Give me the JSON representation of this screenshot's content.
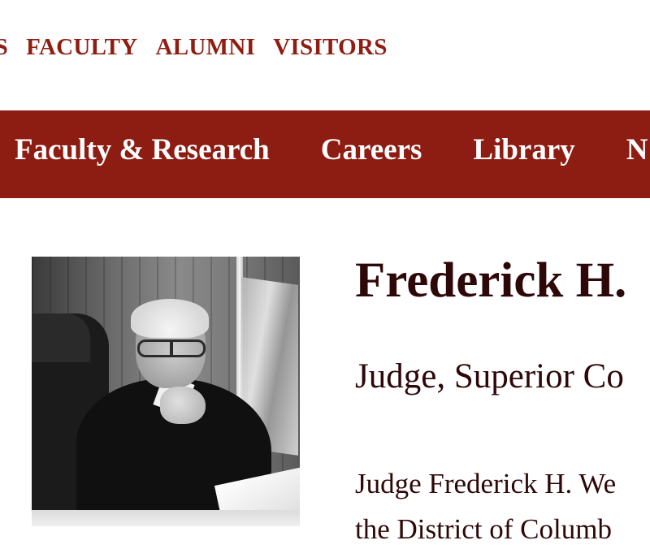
{
  "utility_nav": {
    "items": [
      "TS",
      "FACULTY",
      "ALUMNI",
      "VISITORS"
    ]
  },
  "main_nav": {
    "items": [
      "Faculty & Research",
      "Careers",
      "Library",
      "N"
    ]
  },
  "profile": {
    "photo_alt": "Judge Frederick H.",
    "name": "Frederick H.",
    "title": "Judge, Superior Co",
    "bio_lines": [
      "Judge Frederick H. We",
      "the District of Columb"
    ]
  },
  "colors": {
    "brand_red": "#8d1c13",
    "text_dark": "#2e0808",
    "utility_link": "#8f1d12"
  }
}
